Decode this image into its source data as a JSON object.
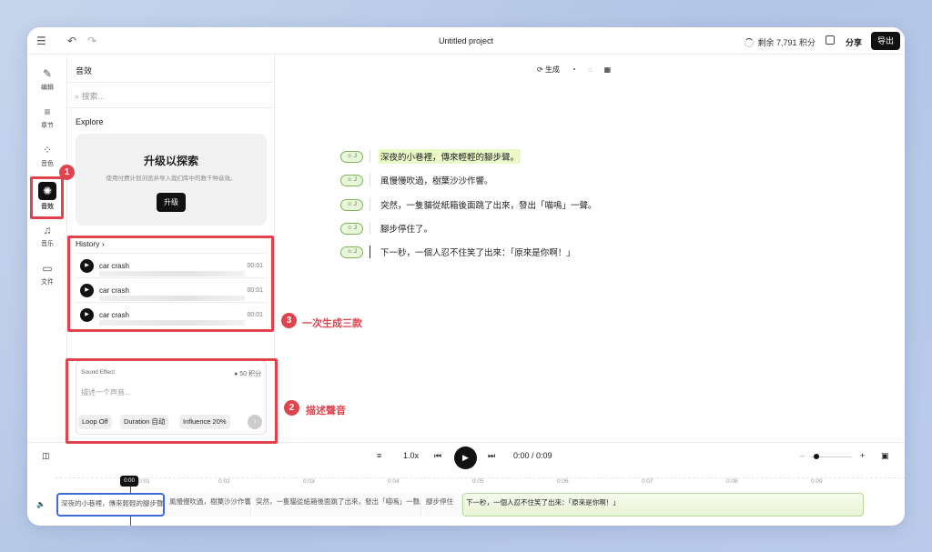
{
  "topbar": {
    "project_title": "Untitled project",
    "credits": "剩余 7,791 积分",
    "share": "分享",
    "export": "导出"
  },
  "rail": {
    "items": [
      {
        "label": "编辑",
        "icon": "edit-icon"
      },
      {
        "label": "章节",
        "icon": "chapter-icon"
      },
      {
        "label": "音色",
        "icon": "voice-icon"
      },
      {
        "label": "音效",
        "icon": "sound-effect-icon"
      },
      {
        "label": "音乐",
        "icon": "music-icon"
      },
      {
        "label": "文件",
        "icon": "file-icon"
      }
    ]
  },
  "sidebar": {
    "title": "音效",
    "search_placeholder": "搜索...",
    "explore": "Explore",
    "upgrade": {
      "title": "升级以探索",
      "desc": "使用付费计划浏览并导入我们库中的数千种音效。",
      "button": "升级"
    },
    "history": {
      "title": "History",
      "items": [
        {
          "name": "car crash",
          "duration": "00:01"
        },
        {
          "name": "car crash",
          "duration": "00:01"
        },
        {
          "name": "car crash",
          "duration": "00:01"
        }
      ]
    },
    "sound_effect": {
      "label": "Sound Effect",
      "cost": "50 积分",
      "placeholder": "描述一个声音...",
      "loop": "Loop Off",
      "duration": "Duration 自动",
      "influence": "Influence 20%"
    }
  },
  "toolbar": {
    "generate": "生成"
  },
  "script": {
    "lines": [
      "深夜的小巷裡，傳來輕輕的腳步聲。",
      "風慢慢吹過，樹葉沙沙作響。",
      "突然，一隻貓從紙箱後面跳了出來，發出「喵嗚」一聲。",
      "腳步停住了。",
      "下一秒，一個人忍不住笑了出來：「原來是你啊！」"
    ]
  },
  "player": {
    "speed": "1.0x",
    "time": "0:00 / 0:09"
  },
  "timeline": {
    "playhead": "0:00",
    "ticks": [
      "0:01",
      "0:02",
      "0:03",
      "0:04",
      "0:05",
      "0:06",
      "0:07",
      "0:08",
      "0:09"
    ],
    "clips": [
      "深夜的小巷裡，傳來輕輕的腳步聲。",
      "風慢慢吹過，樹葉沙沙作響。",
      "突然，一隻貓從紙箱後面跳了出來，發出「喵嗚」一聲。",
      "腳步停住",
      "下一秒，一個人忍不住笑了出來：「原來是你啊！」"
    ]
  },
  "annotations": {
    "n1": "1",
    "n2": "2",
    "n3": "3",
    "a2": "描述聲音",
    "a3": "一次生成三款"
  },
  "colors": {
    "accent_red": "#e0434c",
    "highlight": "#eaf9c7",
    "badge_green": "#7fb35a"
  }
}
